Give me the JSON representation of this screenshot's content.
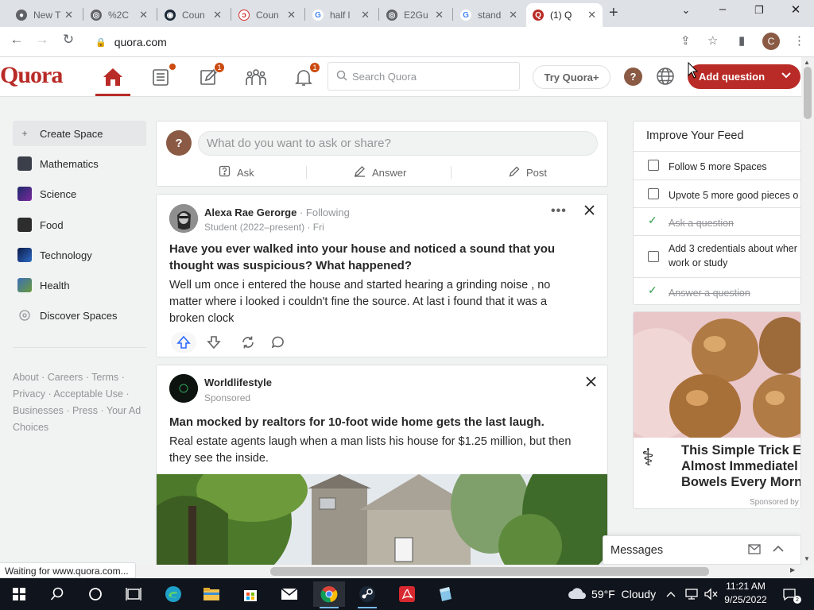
{
  "browser": {
    "tabs": [
      {
        "title": "New T",
        "favicon": "chrome"
      },
      {
        "title": "%2C",
        "favicon": "globe"
      },
      {
        "title": "Coun",
        "favicon": "steam"
      },
      {
        "title": "Coun",
        "favicon": "redboxed"
      },
      {
        "title": "half l",
        "favicon": "google"
      },
      {
        "title": "E2Gu",
        "favicon": "globe"
      },
      {
        "title": "stand",
        "favicon": "google"
      },
      {
        "title": "(1) Q",
        "favicon": "quora",
        "active": true
      }
    ],
    "new_tab_label": "+",
    "url": "quora.com",
    "profile_initial": "C",
    "status_text": "Waiting for www.quora.com..."
  },
  "header": {
    "logo": "Quora",
    "notifications": {
      "answer_badge": "1",
      "bell_badge": "1"
    },
    "search_placeholder": "Search Quora",
    "try_plus_label": "Try Quora+",
    "help_label": "?",
    "add_question_label": "Add question"
  },
  "sidebar": {
    "items": [
      {
        "label": "Create Space",
        "icon": "plus-icon"
      },
      {
        "label": "Mathematics",
        "icon": "space-mathematics-icon"
      },
      {
        "label": "Science",
        "icon": "space-science-icon"
      },
      {
        "label": "Food",
        "icon": "space-food-icon"
      },
      {
        "label": "Technology",
        "icon": "space-technology-icon"
      },
      {
        "label": "Health",
        "icon": "space-health-icon"
      },
      {
        "label": "Discover Spaces",
        "icon": "compass-icon"
      }
    ],
    "footer_links": [
      "About",
      "Careers",
      "Terms",
      "Privacy",
      "Acceptable Use",
      "Businesses",
      "Press",
      "Your Ad Choices"
    ]
  },
  "ask_box": {
    "avatar_label": "?",
    "placeholder": "What do you want to ask or share?",
    "ask_label": "Ask",
    "answer_label": "Answer",
    "post_label": "Post"
  },
  "feed": {
    "post1": {
      "author": "Alexa Rae Gerorge",
      "follow_text": "Following",
      "credential": "Student (2022–present) · Fri",
      "title_line1": "Have you ever walked into your house and noticed a sound that you",
      "title_line2": "thought was suspicious? What happened?",
      "body_line1": "Well um once i entered the house and started hearing a grinding noise , no",
      "body_line2": "matter where i looked i couldn't fine the source. At last i found that it was a",
      "body_line3": "broken clock"
    },
    "post2": {
      "author": "Worldlifestyle",
      "sponsored": "Sponsored",
      "title": "Man mocked by realtors for 10-foot wide home gets the last laugh.",
      "body_line1": "Real estate agents laugh when a man lists his house for $1.25 million, but then",
      "body_line2": "they see the inside."
    }
  },
  "improve_feed": {
    "title": "Improve Your Feed",
    "items": [
      {
        "text": "Follow 5 more Spaces",
        "done": false
      },
      {
        "text": "Upvote 5 more good pieces o",
        "done": false
      },
      {
        "text": "Ask a question",
        "done": true
      },
      {
        "text_line1": "Add 3 credentials about wher",
        "text_line2": "work or study",
        "done": false
      },
      {
        "text": "Answer a question",
        "done": true
      }
    ]
  },
  "right_ad": {
    "line1": "This Simple Trick E",
    "line2": "Almost Immediatel",
    "line3": "Bowels Every Morn",
    "sponsored": "Sponsored by"
  },
  "messages": {
    "label": "Messages"
  },
  "taskbar": {
    "weather": "59°F  Cloudy",
    "time": "11:21 AM",
    "date": "9/25/2022"
  },
  "colors": {
    "quora_red": "#b92b27",
    "upvote_blue": "#2e69ff",
    "badge_orange": "#cb4b10"
  }
}
